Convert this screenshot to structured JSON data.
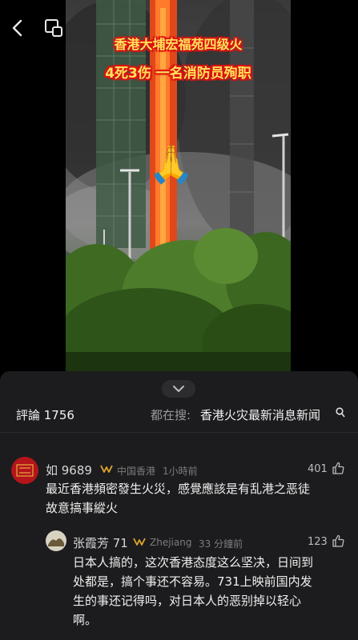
{
  "video": {
    "caption_line1": "香港大埔宏福苑四级火",
    "caption_line2": "4死3伤 一名消防员殉职",
    "emoji": "🙏"
  },
  "comments_panel": {
    "count_label": "評論 1756",
    "search_prefix": "都在搜:",
    "search_query": "香港火灾最新消息新闻"
  },
  "comments": [
    {
      "username": "如 9689",
      "location": "中国香港",
      "time": "1小時前",
      "likes": "401",
      "text_line1": "最近香港頻密發生火災，感覺應該是有乱港之恶徒",
      "text_line2": "故意搞事縱火"
    },
    {
      "username": "张霞芳 71",
      "location": "Zhejiang",
      "time": "33 分鐘前",
      "likes": "123",
      "text_line1": "日本人搞的，这次香港态度这么坚决，日间到",
      "text_line2": "处都是，搞个事还不容易。731上映前国内发",
      "text_line3": "生的事还记得吗，对日本人的恶别掉以轻心",
      "text_line4": "啊。"
    }
  ]
}
